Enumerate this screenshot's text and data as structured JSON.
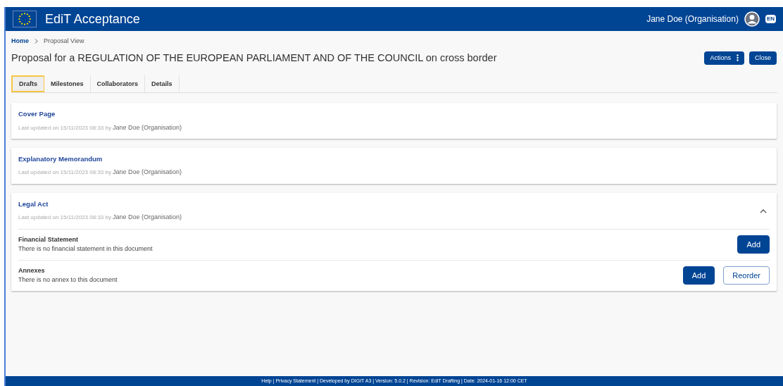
{
  "header": {
    "title": "EdiT Acceptance",
    "user": "Jane Doe (Organisation)",
    "language": "EN"
  },
  "breadcrumb": [
    {
      "label": "Home"
    },
    {
      "label": "Proposal View"
    }
  ],
  "page_title": "Proposal for a REGULATION OF THE EUROPEAN PARLIAMENT AND OF THE COUNCIL on cross border",
  "actions": [
    {
      "label": "Actions",
      "kind": "menu"
    },
    {
      "label": "Close",
      "kind": "plain"
    }
  ],
  "tabs": [
    {
      "label": "Drafts",
      "selected": true
    },
    {
      "label": "Milestones",
      "selected": false
    },
    {
      "label": "Collaborators",
      "selected": false
    },
    {
      "label": "Details",
      "selected": false
    }
  ],
  "documents": [
    {
      "title": "Cover Page",
      "updated": "Last updated on 15/11/2023 08:33 by",
      "author": "Jane Doe (Organisation)",
      "expanded": false
    },
    {
      "title": "Explanatory Memorandum",
      "updated": "Last updated on 15/11/2023 08:33 by",
      "author": "Jane Doe (Organisation)",
      "expanded": false
    },
    {
      "title": "Legal Act",
      "updated": "Last updated on 15/11/2023 08:33 by",
      "author": "Jane Doe (Organisation)",
      "expanded": true,
      "sections": [
        {
          "title": "Financial Statement",
          "text": "There is no financial statement in this document",
          "buttons": [
            {
              "label": "Add",
              "kind": "primary"
            }
          ]
        },
        {
          "title": "Annexes",
          "text": "There is no annex to this document",
          "buttons": [
            {
              "label": "Add",
              "kind": "primary"
            },
            {
              "label": "Reorder",
              "kind": "outline"
            }
          ]
        }
      ]
    }
  ],
  "footer": "Help | Privacy Statement | Developed by DIGIT A3 | Version: 5.0.2 | Revision: EdiT Drafting | Date: 2024-01-16 12:00 CET"
}
